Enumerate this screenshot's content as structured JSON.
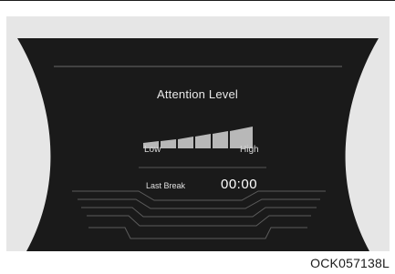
{
  "display": {
    "title": "Attention Level",
    "scale": {
      "low_label": "Low",
      "high_label": "High",
      "segments": 6
    },
    "last_break": {
      "label": "Last Break",
      "value": "00:00"
    }
  },
  "figure_code": "OCK057138L",
  "colors": {
    "screen": "#1a1a1a",
    "panel": "#e6e6e6",
    "text": "#e8e8e8"
  }
}
